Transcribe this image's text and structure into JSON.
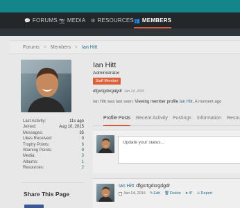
{
  "nav": {
    "forums": "FORUMS",
    "media": "MEDIA",
    "resources": "RESOURCES",
    "members": "MEMBERS"
  },
  "breadcrumb": {
    "forums": "Forums",
    "members": "Members",
    "current": "Ian Hitt"
  },
  "stats": [
    {
      "label": "Last Activity:",
      "value": "11s ago"
    },
    {
      "label": "Joined:",
      "value": "Aug 10, 2015"
    },
    {
      "label": "Messages:",
      "value": "35"
    },
    {
      "label": "Likes Received:",
      "value": "0"
    },
    {
      "label": "Trophy Points:",
      "value": "6"
    },
    {
      "label": "Warning Points:",
      "value": "0"
    },
    {
      "label": "Media:",
      "value": "3"
    },
    {
      "label": "Albums:",
      "value": "1"
    },
    {
      "label": "Resources:",
      "value": "2"
    }
  ],
  "share": {
    "title": "Share This Page"
  },
  "member": {
    "name": "Ian Hitt",
    "title": "Administrator",
    "badge": "Staff Member",
    "status": "dfgxrtgdxrgdgdr",
    "status_date": "Jan 14, 2016",
    "last_seen_prefix": "Ian Hitt was last seen:",
    "last_seen_action": "Viewing member profile",
    "last_seen_link": "Ian Hitt",
    "last_seen_suffix": ", A moment ago"
  },
  "tabs": [
    "Profile Posts",
    "Recent Activity",
    "Postings",
    "Information",
    "Resou"
  ],
  "post_box": {
    "placeholder": "Update your status..."
  },
  "feed": {
    "name": "Ian Hitt",
    "message": "dfgxrtgdxrgdgdr",
    "date": "Jan 14, 2016",
    "actions": {
      "edit": "Edit",
      "delete": "Delete",
      "ip": "IP",
      "report": "Report"
    }
  },
  "colors": {
    "accent": "#d45a40",
    "teal": "#14858a",
    "link": "#2c6c8c",
    "nav_bg": "#23272a"
  },
  "icons": {
    "forums": "speech-bubble-icon",
    "media": "camera-icon",
    "resources": "gear-icon",
    "members": "people-icon"
  }
}
